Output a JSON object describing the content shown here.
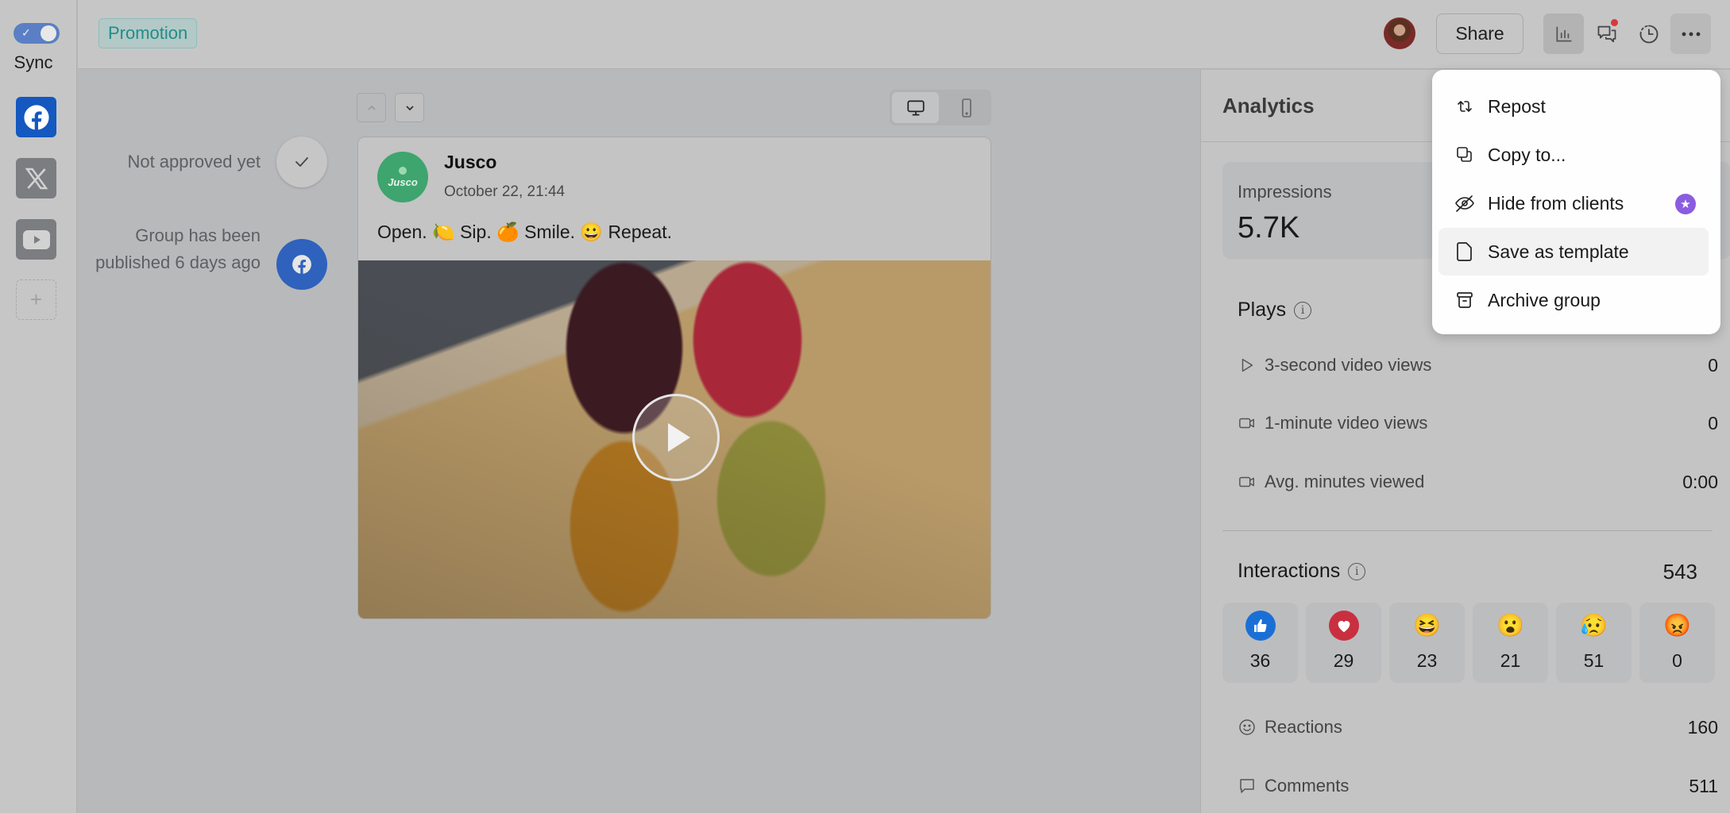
{
  "sidebar": {
    "sync_label": "Sync",
    "sync_enabled": true,
    "networks": [
      {
        "name": "Facebook",
        "icon": "facebook-icon",
        "active": true
      },
      {
        "name": "X",
        "icon": "x-icon",
        "active": false
      },
      {
        "name": "YouTube",
        "icon": "youtube-icon",
        "active": false
      }
    ],
    "add_label": "+"
  },
  "header": {
    "tag": "Promotion",
    "share_label": "Share",
    "icons": [
      "analytics-icon",
      "comments-icon",
      "history-icon",
      "more-icon"
    ],
    "comments_has_notification": true
  },
  "status": {
    "approval": "Not approved yet",
    "published": "Group has been published 6 days ago"
  },
  "post": {
    "author": "Jusco",
    "logo_text": "Jusco",
    "date": "October 22, 21:44",
    "text": "Open. 🍋 Sip. 🍊 Smile. 😀 Repeat.",
    "media_type": "video"
  },
  "analytics": {
    "title": "Analytics",
    "impressions": {
      "label": "Impressions",
      "value": "5.7K"
    },
    "plays": {
      "title": "Plays",
      "metrics": [
        {
          "label": "3-second video views",
          "value": "0",
          "icon": "play-icon"
        },
        {
          "label": "1-minute video views",
          "value": "0",
          "icon": "video-icon"
        },
        {
          "label": "Avg. minutes viewed",
          "value": "0:00",
          "icon": "video-icon"
        }
      ]
    },
    "interactions": {
      "title": "Interactions",
      "total": "543",
      "reactions": [
        {
          "type": "like",
          "emoji": "👍",
          "count": "36",
          "color": "#1877f2"
        },
        {
          "type": "love",
          "emoji": "♥",
          "count": "29",
          "color": "#e0324a"
        },
        {
          "type": "haha",
          "emoji": "😆",
          "count": "23"
        },
        {
          "type": "wow",
          "emoji": "😮",
          "count": "21"
        },
        {
          "type": "sad",
          "emoji": "😥",
          "count": "51"
        },
        {
          "type": "angry",
          "emoji": "😡",
          "count": "0"
        }
      ],
      "metrics": [
        {
          "label": "Reactions",
          "value": "160",
          "icon": "smile-icon"
        },
        {
          "label": "Comments",
          "value": "511",
          "icon": "comment-icon"
        }
      ]
    }
  },
  "menu": {
    "items": [
      {
        "label": "Repost",
        "icon": "repost-icon"
      },
      {
        "label": "Copy to...",
        "icon": "copy-icon"
      },
      {
        "label": "Hide from clients",
        "icon": "eye-off-icon",
        "badge": "pro-star"
      },
      {
        "label": "Save as template",
        "icon": "file-icon",
        "hovered": true
      },
      {
        "label": "Archive group",
        "icon": "archive-icon"
      }
    ]
  }
}
